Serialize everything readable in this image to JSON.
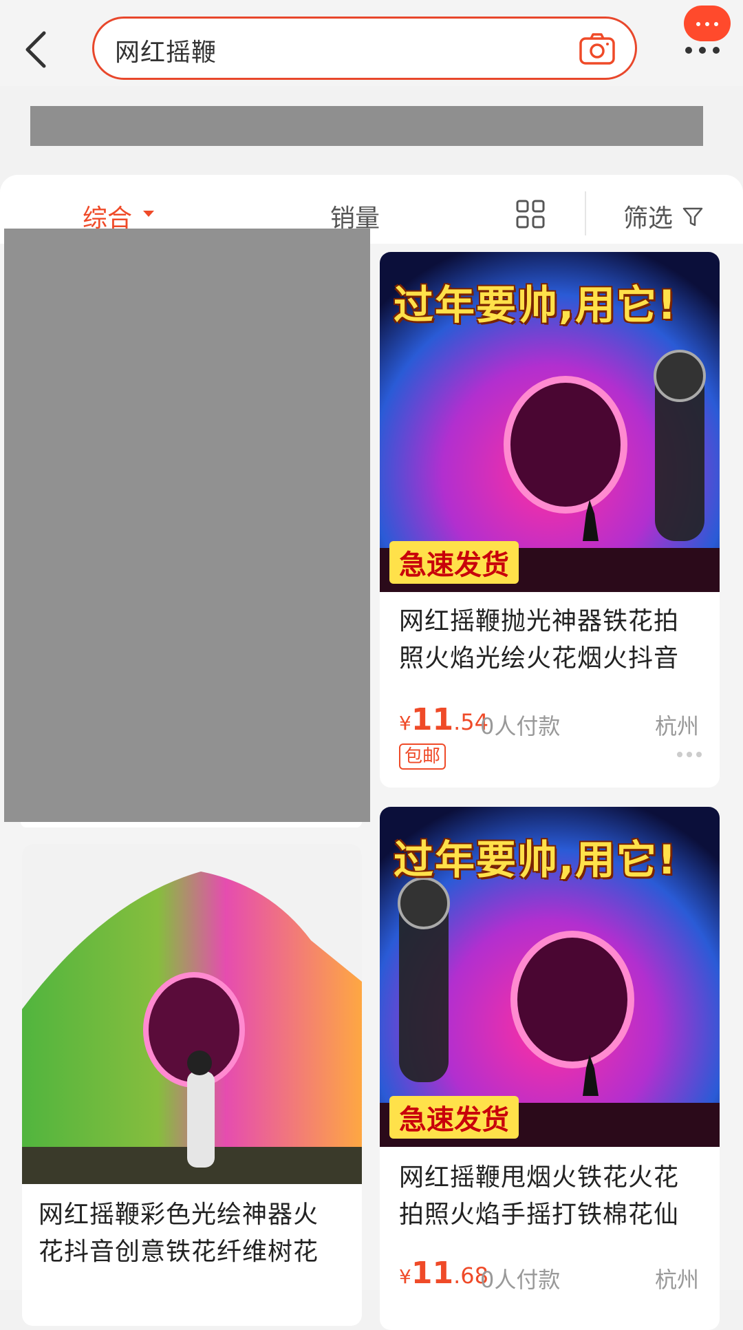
{
  "header": {
    "search_query": "网红摇鞭"
  },
  "filters": {
    "tabs": [
      "综合",
      "销量"
    ],
    "filter_label": "筛选"
  },
  "products": [
    {
      "banner": "过年要帅,用它!",
      "badge": "急速发货",
      "title_line1": "网红摇鞭抛光神器铁花拍",
      "title_line2": "照火焰光绘火花烟火抖音",
      "price_symbol": "¥",
      "price_int": "11",
      "price_dec": ".54",
      "sales": "0人付款",
      "location": "杭州",
      "tag": "包邮"
    },
    {
      "title_line1": "网红摇鞭彩色光绘神器火",
      "title_line2": "花抖音创意铁花纤维树花"
    },
    {
      "banner": "过年要帅,用它!",
      "badge": "急速发货",
      "title_line1": "网红摇鞭甩烟火铁花火花",
      "title_line2": "拍照火焰手摇打铁棉花仙",
      "price_symbol": "¥",
      "price_int": "11",
      "price_dec": ".68",
      "sales": "0人付款",
      "location": "杭州"
    }
  ],
  "colors": {
    "accent": "#ef4a28",
    "price": "#ef4a28"
  }
}
